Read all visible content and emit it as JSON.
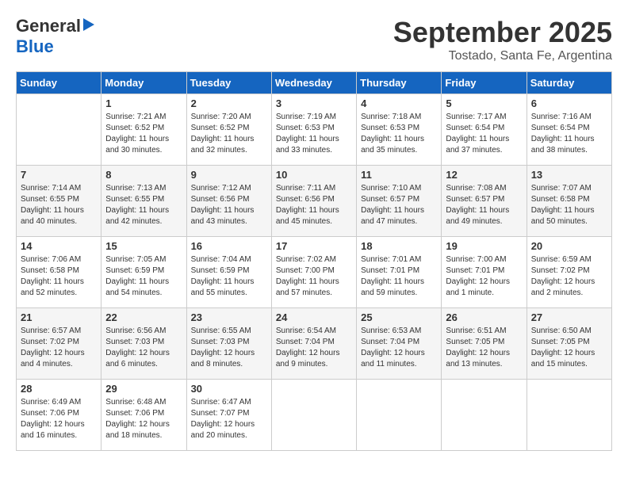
{
  "header": {
    "logo_general": "General",
    "logo_blue": "Blue",
    "title": "September 2025",
    "location": "Tostado, Santa Fe, Argentina"
  },
  "weekdays": [
    "Sunday",
    "Monday",
    "Tuesday",
    "Wednesday",
    "Thursday",
    "Friday",
    "Saturday"
  ],
  "weeks": [
    [
      {
        "day": "",
        "sunrise": "",
        "sunset": "",
        "daylight": ""
      },
      {
        "day": "1",
        "sunrise": "Sunrise: 7:21 AM",
        "sunset": "Sunset: 6:52 PM",
        "daylight": "Daylight: 11 hours and 30 minutes."
      },
      {
        "day": "2",
        "sunrise": "Sunrise: 7:20 AM",
        "sunset": "Sunset: 6:52 PM",
        "daylight": "Daylight: 11 hours and 32 minutes."
      },
      {
        "day": "3",
        "sunrise": "Sunrise: 7:19 AM",
        "sunset": "Sunset: 6:53 PM",
        "daylight": "Daylight: 11 hours and 33 minutes."
      },
      {
        "day": "4",
        "sunrise": "Sunrise: 7:18 AM",
        "sunset": "Sunset: 6:53 PM",
        "daylight": "Daylight: 11 hours and 35 minutes."
      },
      {
        "day": "5",
        "sunrise": "Sunrise: 7:17 AM",
        "sunset": "Sunset: 6:54 PM",
        "daylight": "Daylight: 11 hours and 37 minutes."
      },
      {
        "day": "6",
        "sunrise": "Sunrise: 7:16 AM",
        "sunset": "Sunset: 6:54 PM",
        "daylight": "Daylight: 11 hours and 38 minutes."
      }
    ],
    [
      {
        "day": "7",
        "sunrise": "Sunrise: 7:14 AM",
        "sunset": "Sunset: 6:55 PM",
        "daylight": "Daylight: 11 hours and 40 minutes."
      },
      {
        "day": "8",
        "sunrise": "Sunrise: 7:13 AM",
        "sunset": "Sunset: 6:55 PM",
        "daylight": "Daylight: 11 hours and 42 minutes."
      },
      {
        "day": "9",
        "sunrise": "Sunrise: 7:12 AM",
        "sunset": "Sunset: 6:56 PM",
        "daylight": "Daylight: 11 hours and 43 minutes."
      },
      {
        "day": "10",
        "sunrise": "Sunrise: 7:11 AM",
        "sunset": "Sunset: 6:56 PM",
        "daylight": "Daylight: 11 hours and 45 minutes."
      },
      {
        "day": "11",
        "sunrise": "Sunrise: 7:10 AM",
        "sunset": "Sunset: 6:57 PM",
        "daylight": "Daylight: 11 hours and 47 minutes."
      },
      {
        "day": "12",
        "sunrise": "Sunrise: 7:08 AM",
        "sunset": "Sunset: 6:57 PM",
        "daylight": "Daylight: 11 hours and 49 minutes."
      },
      {
        "day": "13",
        "sunrise": "Sunrise: 7:07 AM",
        "sunset": "Sunset: 6:58 PM",
        "daylight": "Daylight: 11 hours and 50 minutes."
      }
    ],
    [
      {
        "day": "14",
        "sunrise": "Sunrise: 7:06 AM",
        "sunset": "Sunset: 6:58 PM",
        "daylight": "Daylight: 11 hours and 52 minutes."
      },
      {
        "day": "15",
        "sunrise": "Sunrise: 7:05 AM",
        "sunset": "Sunset: 6:59 PM",
        "daylight": "Daylight: 11 hours and 54 minutes."
      },
      {
        "day": "16",
        "sunrise": "Sunrise: 7:04 AM",
        "sunset": "Sunset: 6:59 PM",
        "daylight": "Daylight: 11 hours and 55 minutes."
      },
      {
        "day": "17",
        "sunrise": "Sunrise: 7:02 AM",
        "sunset": "Sunset: 7:00 PM",
        "daylight": "Daylight: 11 hours and 57 minutes."
      },
      {
        "day": "18",
        "sunrise": "Sunrise: 7:01 AM",
        "sunset": "Sunset: 7:01 PM",
        "daylight": "Daylight: 11 hours and 59 minutes."
      },
      {
        "day": "19",
        "sunrise": "Sunrise: 7:00 AM",
        "sunset": "Sunset: 7:01 PM",
        "daylight": "Daylight: 12 hours and 1 minute."
      },
      {
        "day": "20",
        "sunrise": "Sunrise: 6:59 AM",
        "sunset": "Sunset: 7:02 PM",
        "daylight": "Daylight: 12 hours and 2 minutes."
      }
    ],
    [
      {
        "day": "21",
        "sunrise": "Sunrise: 6:57 AM",
        "sunset": "Sunset: 7:02 PM",
        "daylight": "Daylight: 12 hours and 4 minutes."
      },
      {
        "day": "22",
        "sunrise": "Sunrise: 6:56 AM",
        "sunset": "Sunset: 7:03 PM",
        "daylight": "Daylight: 12 hours and 6 minutes."
      },
      {
        "day": "23",
        "sunrise": "Sunrise: 6:55 AM",
        "sunset": "Sunset: 7:03 PM",
        "daylight": "Daylight: 12 hours and 8 minutes."
      },
      {
        "day": "24",
        "sunrise": "Sunrise: 6:54 AM",
        "sunset": "Sunset: 7:04 PM",
        "daylight": "Daylight: 12 hours and 9 minutes."
      },
      {
        "day": "25",
        "sunrise": "Sunrise: 6:53 AM",
        "sunset": "Sunset: 7:04 PM",
        "daylight": "Daylight: 12 hours and 11 minutes."
      },
      {
        "day": "26",
        "sunrise": "Sunrise: 6:51 AM",
        "sunset": "Sunset: 7:05 PM",
        "daylight": "Daylight: 12 hours and 13 minutes."
      },
      {
        "day": "27",
        "sunrise": "Sunrise: 6:50 AM",
        "sunset": "Sunset: 7:05 PM",
        "daylight": "Daylight: 12 hours and 15 minutes."
      }
    ],
    [
      {
        "day": "28",
        "sunrise": "Sunrise: 6:49 AM",
        "sunset": "Sunset: 7:06 PM",
        "daylight": "Daylight: 12 hours and 16 minutes."
      },
      {
        "day": "29",
        "sunrise": "Sunrise: 6:48 AM",
        "sunset": "Sunset: 7:06 PM",
        "daylight": "Daylight: 12 hours and 18 minutes."
      },
      {
        "day": "30",
        "sunrise": "Sunrise: 6:47 AM",
        "sunset": "Sunset: 7:07 PM",
        "daylight": "Daylight: 12 hours and 20 minutes."
      },
      {
        "day": "",
        "sunrise": "",
        "sunset": "",
        "daylight": ""
      },
      {
        "day": "",
        "sunrise": "",
        "sunset": "",
        "daylight": ""
      },
      {
        "day": "",
        "sunrise": "",
        "sunset": "",
        "daylight": ""
      },
      {
        "day": "",
        "sunrise": "",
        "sunset": "",
        "daylight": ""
      }
    ]
  ]
}
